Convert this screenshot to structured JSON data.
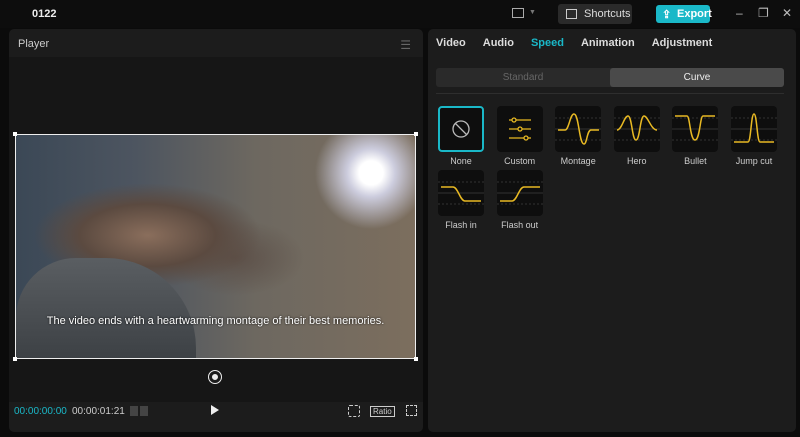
{
  "window": {
    "title": "0122",
    "shortcuts_label": "Shortcuts",
    "export_label": "Export"
  },
  "player": {
    "title": "Player",
    "caption": "The video ends with a heartwarming montage of their best memories.",
    "current_time": "00:00:00:00",
    "total_time": "00:00:01:21",
    "ratio_label": "Ratio"
  },
  "inspector": {
    "tabs": [
      {
        "label": "Video"
      },
      {
        "label": "Audio"
      },
      {
        "label": "Speed"
      },
      {
        "label": "Animation"
      },
      {
        "label": "Adjustment"
      }
    ],
    "active_tab": "Speed",
    "modes": [
      {
        "label": "Standard"
      },
      {
        "label": "Curve"
      }
    ],
    "active_mode": "Curve",
    "presets": [
      {
        "label": "None"
      },
      {
        "label": "Custom"
      },
      {
        "label": "Montage"
      },
      {
        "label": "Hero"
      },
      {
        "label": "Bullet"
      },
      {
        "label": "Jump cut"
      },
      {
        "label": "Flash in"
      },
      {
        "label": "Flash out"
      }
    ],
    "selected_preset": "None"
  },
  "colors": {
    "accent": "#1ab8c8",
    "curve": "#e8b923"
  }
}
